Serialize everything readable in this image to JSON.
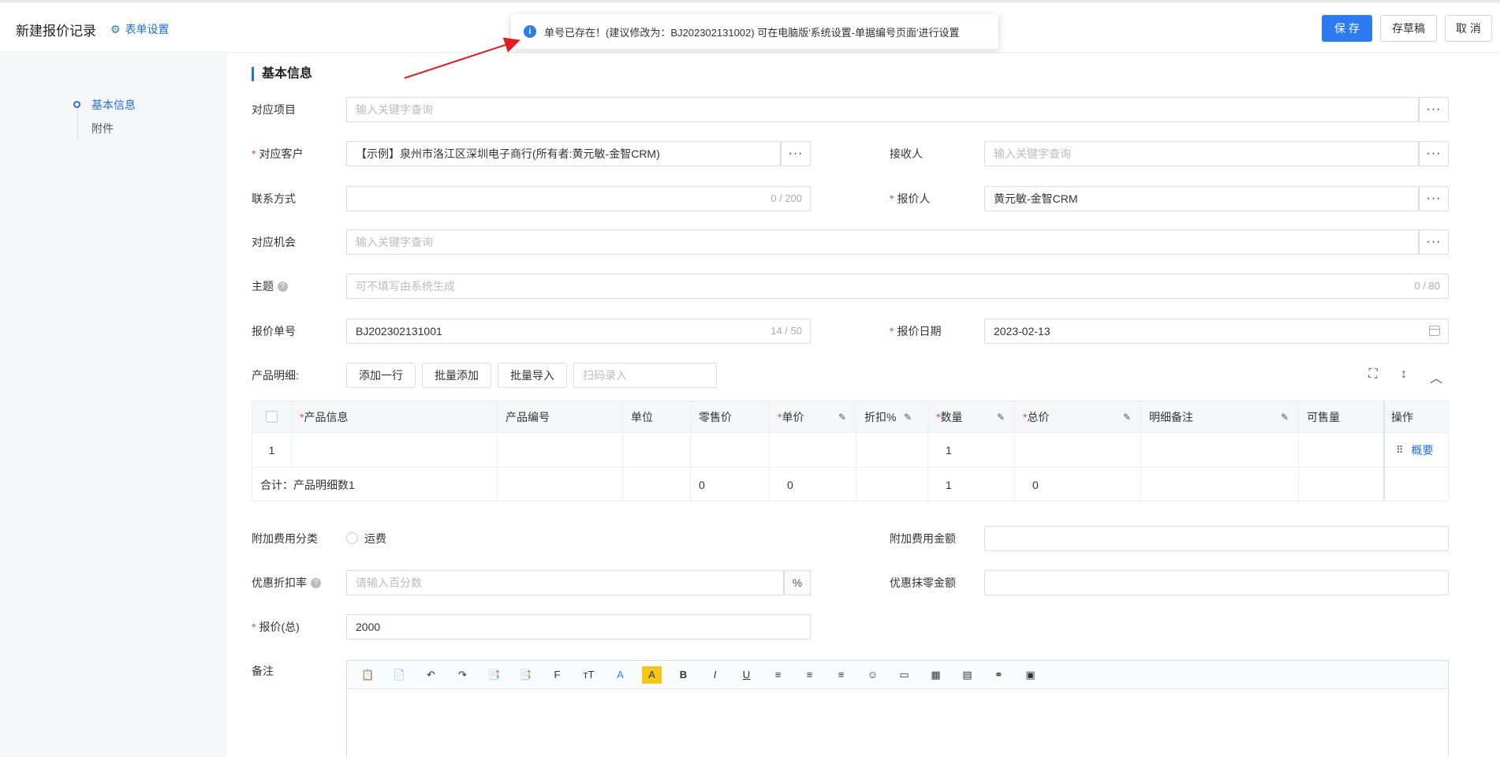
{
  "header": {
    "title": "新建报价记录",
    "form_settings": "表单设置",
    "save": "保 存",
    "draft": "存草稿",
    "cancel": "取 消"
  },
  "toast": {
    "message": "单号已存在！(建议修改为：BJ202302131002) 可在电脑版'系统设置-单据编号页面'进行设置"
  },
  "nav": {
    "items": [
      "基本信息",
      "附件"
    ]
  },
  "section": {
    "title": "基本信息"
  },
  "form": {
    "project": {
      "label": "对应项目",
      "placeholder": "输入关键字查询"
    },
    "customer": {
      "label": "对应客户",
      "value": "【示例】泉州市洛江区深圳电子商行(所有者:黄元敏-金智CRM)"
    },
    "receiver": {
      "label": "接收人",
      "placeholder": "输入关键字查询"
    },
    "contact": {
      "label": "联系方式",
      "count": "0 / 200"
    },
    "quoter": {
      "label": "报价人",
      "value": "黄元敏-金智CRM"
    },
    "opportunity": {
      "label": "对应机会",
      "placeholder": "输入关键字查询"
    },
    "subject": {
      "label": "主题",
      "placeholder": "可不填写由系统生成",
      "count": "0 / 80"
    },
    "quote_no": {
      "label": "报价单号",
      "value": "BJ202302131001",
      "count": "14 / 50"
    },
    "quote_date": {
      "label": "报价日期",
      "value": "2023-02-13"
    },
    "products_label": "产品明细:",
    "extra_type": {
      "label": "附加费用分类",
      "option": "运费"
    },
    "extra_amount": {
      "label": "附加费用金额"
    },
    "discount_rate": {
      "label": "优惠折扣率",
      "placeholder": "请输入百分数",
      "suffix": "%"
    },
    "round_amount": {
      "label": "优惠抹零金额"
    },
    "total": {
      "label": "报价(总)",
      "value": "2000"
    },
    "remark": {
      "label": "备注"
    }
  },
  "product_toolbar": {
    "add_row": "添加一行",
    "batch_add": "批量添加",
    "batch_import": "批量导入",
    "scan_placeholder": "扫码录入"
  },
  "table": {
    "headers": {
      "product_info": "产品信息",
      "product_code": "产品编号",
      "unit": "单位",
      "retail": "零售价",
      "price": "单价",
      "discount": "折扣%",
      "qty": "数量",
      "total": "总价",
      "note": "明细备注",
      "available": "可售量",
      "op": "操作"
    },
    "row1": {
      "index": "1",
      "qty": "1",
      "op": "概要"
    },
    "summary": {
      "label": "合计：产品明细数1",
      "retail": "0",
      "price": "0",
      "qty": "1",
      "total": "0"
    }
  },
  "editor_tools": [
    "📋",
    "📄",
    "↶",
    "↷",
    "📑",
    "📑",
    "F",
    "тT",
    "A",
    "A",
    "B",
    "I",
    "U",
    "≡",
    "≡",
    "≡",
    "☺",
    "▭",
    "▦",
    "▤",
    "⚭",
    "▣"
  ]
}
